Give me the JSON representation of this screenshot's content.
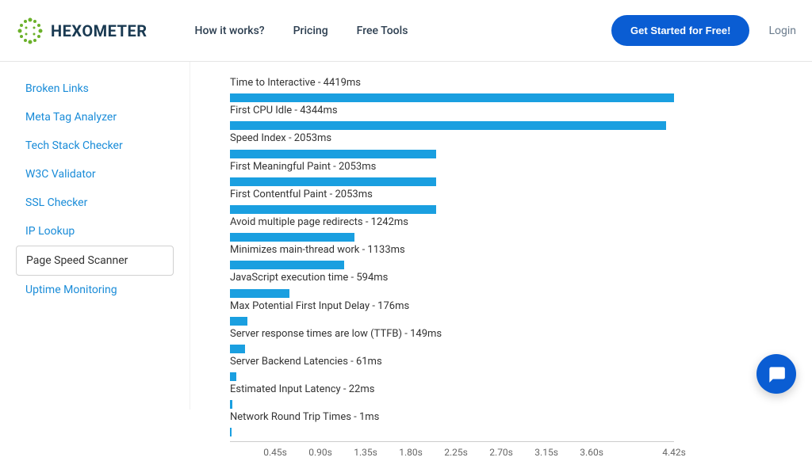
{
  "header": {
    "brand": "HEXOMETER",
    "nav": [
      {
        "label": "How it works?"
      },
      {
        "label": "Pricing"
      },
      {
        "label": "Free Tools"
      }
    ],
    "cta": "Get Started for Free!",
    "login": "Login"
  },
  "sidebar": {
    "items": [
      {
        "label": "Broken Links",
        "active": false
      },
      {
        "label": "Meta Tag Analyzer",
        "active": false
      },
      {
        "label": "Tech Stack Checker",
        "active": false
      },
      {
        "label": "W3C Validator",
        "active": false
      },
      {
        "label": "SSL Checker",
        "active": false
      },
      {
        "label": "IP Lookup",
        "active": false
      },
      {
        "label": "Page Speed Scanner",
        "active": true
      },
      {
        "label": "Uptime Monitoring",
        "active": false
      }
    ]
  },
  "chart_data": {
    "type": "bar",
    "title": "",
    "xlabel": "",
    "ylabel": "",
    "orientation": "horizontal",
    "x_unit": "s",
    "xlim": [
      0,
      4.42
    ],
    "categories": [
      "Time to Interactive",
      "First CPU Idle",
      "Speed Index",
      "First Meaningful Paint",
      "First Contentful Paint",
      "Avoid multiple page redirects",
      "Minimizes main-thread work",
      "JavaScript execution time",
      "Max Potential First Input Delay",
      "Server response times are low (TTFB)",
      "Server Backend Latencies",
      "Estimated Input Latency",
      "Network Round Trip Times"
    ],
    "values": [
      4419,
      4344,
      2053,
      2053,
      2053,
      1242,
      1133,
      594,
      176,
      149,
      61,
      22,
      1
    ],
    "value_unit": "ms",
    "axis_ticks": [
      "0.45s",
      "0.90s",
      "1.35s",
      "1.80s",
      "2.25s",
      "2.70s",
      "3.15s",
      "3.60s",
      "4.42s"
    ],
    "bar_color": "#1a9fe0"
  }
}
